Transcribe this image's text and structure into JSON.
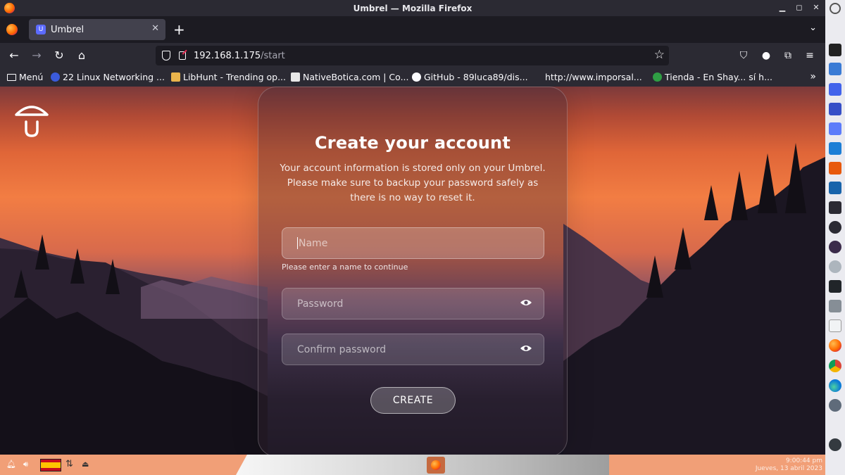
{
  "window": {
    "title": "Umbrel — Mozilla Firefox"
  },
  "tab": {
    "title": "Umbrel"
  },
  "urlbar": {
    "host": "192.168.1.175",
    "path": "/start"
  },
  "bookmarks": [
    {
      "label": "Menú"
    },
    {
      "label": "22 Linux Networking ..."
    },
    {
      "label": "LibHunt - Trending op..."
    },
    {
      "label": "NativeBotica.com | Co..."
    },
    {
      "label": "GitHub - 89luca89/dis..."
    },
    {
      "label": "http://www.imporsal..."
    },
    {
      "label": "Tienda - En Shay... sí h..."
    }
  ],
  "form": {
    "title": "Create your account",
    "description": "Your account information is stored only on your Umbrel. Please make sure to backup your password safely as there is no way to reset it.",
    "name_placeholder": "Name",
    "name_hint": "Please enter a name to continue",
    "password_placeholder": "Password",
    "confirm_placeholder": "Confirm password",
    "create_label": "CREATE"
  },
  "taskbar": {
    "clock_time": "9:00:44 pm",
    "clock_date": "Jueves, 13 abril 2023"
  },
  "colors": {
    "browser_bg": "#1c1b22",
    "toolbar_bg": "#2b2a33",
    "taskbar_bg": "#f19f77",
    "dock_bg": "#ebebf0"
  }
}
